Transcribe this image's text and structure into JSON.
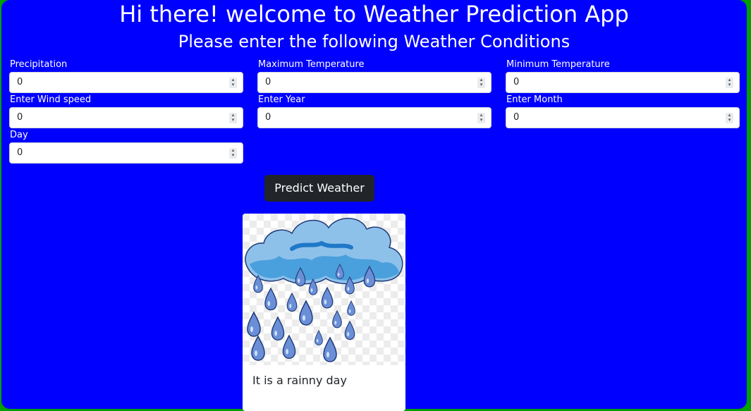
{
  "header": {
    "title": "Hi there! welcome to Weather Prediction App",
    "subtitle": "Please enter the following Weather Conditions"
  },
  "form": {
    "fields": [
      {
        "label": "Precipitation",
        "value": "0"
      },
      {
        "label": "Maximum Temperature",
        "value": "0"
      },
      {
        "label": "Minimum Temperature",
        "value": "0"
      },
      {
        "label": "Enter Wind speed",
        "value": "0"
      },
      {
        "label": "Enter Year",
        "value": "0"
      },
      {
        "label": "Enter Month",
        "value": "0"
      },
      {
        "label": "Day",
        "value": "0"
      }
    ],
    "submit_label": "Predict Weather"
  },
  "result": {
    "image": "rain-cloud-illustration",
    "text": "It is a rainny day"
  },
  "colors": {
    "page_border": "#00a000",
    "panel": "#0000ff",
    "button": "#212529"
  }
}
